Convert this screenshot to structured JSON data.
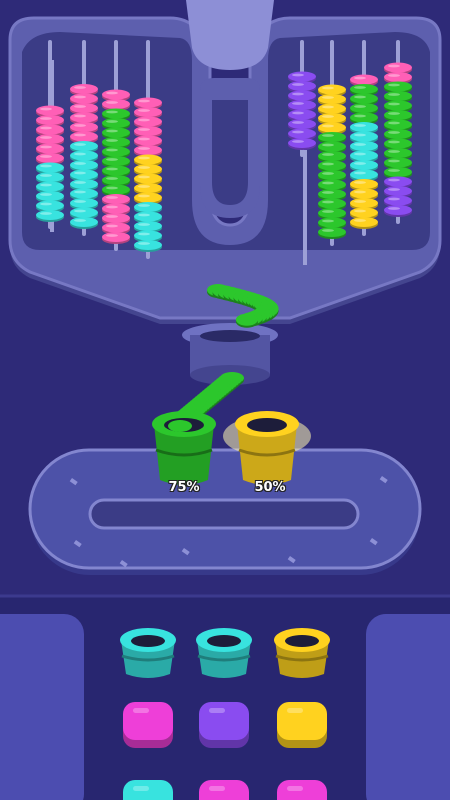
{
  "colors": {
    "background": "#2e2a78",
    "machine": "#5d5fae",
    "machine_dark": "#44458f",
    "tray": "#4d52a8",
    "pink": "#ff5fb6",
    "cyan": "#38e3df",
    "green": "#2cc72c",
    "yellow": "#ffd21f",
    "purple": "#8a4cf0",
    "magenta": "#ee3fd8"
  },
  "hopper": {
    "left_rods": [
      [
        "pink",
        "pink",
        "pink",
        "pink",
        "pink",
        "pink",
        "cyan",
        "cyan",
        "cyan",
        "cyan",
        "cyan",
        "cyan"
      ],
      [
        "pink",
        "pink",
        "pink",
        "pink",
        "pink",
        "pink",
        "cyan",
        "cyan",
        "cyan",
        "cyan",
        "cyan",
        "cyan",
        "cyan",
        "cyan",
        "cyan"
      ],
      [
        "pink",
        "pink",
        "green",
        "green",
        "green",
        "green",
        "green",
        "green",
        "green",
        "green",
        "green",
        "pink",
        "pink",
        "pink",
        "pink",
        "pink"
      ],
      [
        "pink",
        "pink",
        "pink",
        "pink",
        "pink",
        "pink",
        "yellow",
        "yellow",
        "yellow",
        "yellow",
        "yellow",
        "cyan",
        "cyan",
        "cyan",
        "cyan",
        "cyan"
      ]
    ],
    "right_rods": [
      [
        "purple",
        "purple",
        "purple",
        "purple",
        "purple",
        "purple",
        "purple",
        "purple"
      ],
      [
        "yellow",
        "yellow",
        "yellow",
        "yellow",
        "yellow",
        "green",
        "green",
        "green",
        "green",
        "green",
        "green",
        "green",
        "green",
        "green",
        "green",
        "green"
      ],
      [
        "pink",
        "green",
        "green",
        "green",
        "green",
        "cyan",
        "cyan",
        "cyan",
        "cyan",
        "cyan",
        "cyan",
        "yellow",
        "yellow",
        "yellow",
        "yellow",
        "yellow"
      ],
      [
        "pink",
        "pink",
        "green",
        "green",
        "green",
        "green",
        "green",
        "green",
        "green",
        "green",
        "green",
        "green",
        "purple",
        "purple",
        "purple",
        "purple"
      ]
    ]
  },
  "active_cups": [
    {
      "color": "green",
      "fill": 0.75,
      "label": "75%"
    },
    {
      "color": "yellow",
      "fill": 0.5,
      "label": "50%"
    }
  ],
  "queue": [
    [
      "cyan",
      "cyan",
      "yellow"
    ],
    [
      "magenta",
      "purple",
      "yellow"
    ],
    [
      "cyan",
      "magenta",
      "magenta"
    ]
  ]
}
